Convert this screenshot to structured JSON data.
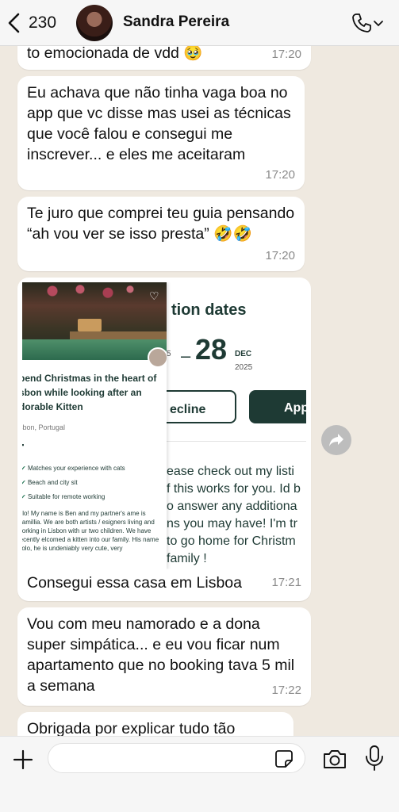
{
  "header": {
    "back_count": "230",
    "contact_name": "Sandra Pereira"
  },
  "messages": [
    {
      "text": "to emocionada de vdd 🥹",
      "time": "17:20"
    },
    {
      "text": "Eu achava que não tinha vaga boa no app que vc disse mas usei as técnicas que você falou e consegui me inscrever... e eles me aceitaram",
      "time": "17:20"
    },
    {
      "text": "Te juro que comprei teu guia pensando “ah vou ver se isso presta” 🤣🤣",
      "time": "17:20"
    },
    {
      "text": "Consegui essa casa em Lisboa",
      "time": "17:21"
    },
    {
      "text": "Vou com meu namorado e a dona super simpática... e eu vou ficar num apartamento que no booking tava 5 mil a semana",
      "time": "17:22"
    },
    {
      "text": "Obrigada por explicar tudo tão",
      "time": ""
    }
  ],
  "screenshot": {
    "right": {
      "title": "tion dates",
      "start_partial": "5",
      "end_day": "28",
      "end_month": "DEC",
      "end_year": "2025",
      "decline": "ecline",
      "apply": "App",
      "message_lines": [
        "ease check out my listi",
        "f this works for you. Id b",
        "o answer any additiona",
        "ns you may have! I'm tr",
        "to go home for Christm",
        "family !"
      ]
    },
    "left": {
      "title": "pend Christmas in the heart of sbon while looking after an dorable Kitten",
      "location": "sbon, Portugal",
      "features": [
        "Matches your experience with cats",
        "Beach and city sit",
        "Suitable for remote working"
      ],
      "description": "ello! My name is Ben and my partner's ame is Camillia. We are both artists / esigners living and working in Lisbon with ur two children. We have recently elcomed a kitten into our family. His name Bolo, he is undeniably very cute, very"
    }
  },
  "composer": {
    "placeholder": ""
  }
}
